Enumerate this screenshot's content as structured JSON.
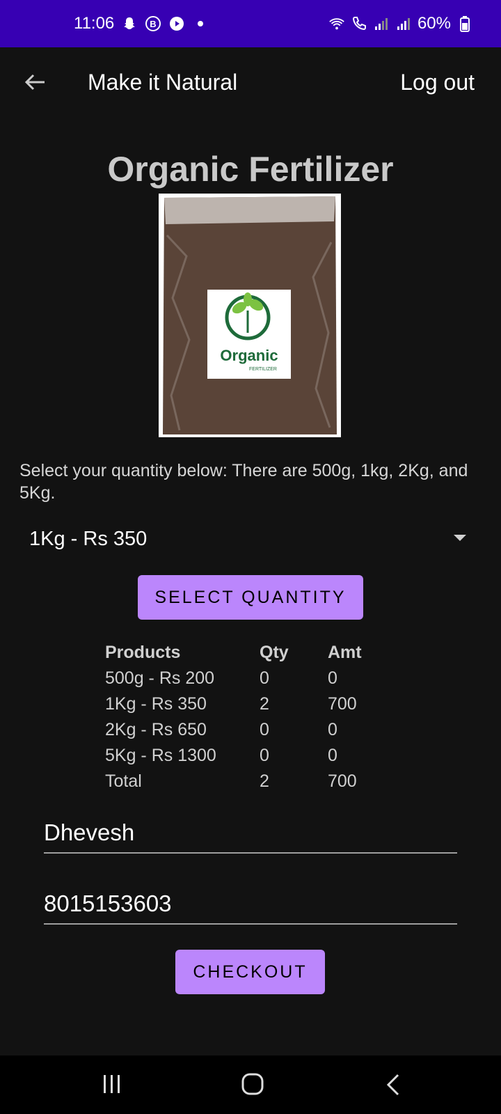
{
  "status_bar": {
    "time": "11:06",
    "battery": "60%",
    "left_icons": [
      "snapchat-icon",
      "b-icon",
      "play-icon",
      "dot-icon"
    ],
    "right_icons": [
      "wifi-icon",
      "call-icon",
      "signal-icon",
      "signal-icon",
      "battery-icon"
    ]
  },
  "app_bar": {
    "title": "Make it Natural",
    "logout_label": "Log out"
  },
  "product": {
    "title": "Organic Fertilizer",
    "image_label": "Organic",
    "image_sublabel": "FERTILIZER"
  },
  "description": "Select your quantity below: There are 500g, 1kg, 2Kg, and 5Kg.",
  "quantity_dropdown": {
    "selected": "1Kg - Rs 350"
  },
  "select_button_label": "Select Quantity",
  "order_table": {
    "headers": [
      "Products",
      "Qty",
      "Amt"
    ],
    "rows": [
      [
        "500g - Rs 200",
        "0",
        "0"
      ],
      [
        "1Kg - Rs 350",
        "2",
        "700"
      ],
      [
        "2Kg - Rs 650",
        "0",
        "0"
      ],
      [
        "5Kg - Rs 1300",
        "0",
        "0"
      ],
      [
        "Total",
        "2",
        "700"
      ]
    ]
  },
  "form": {
    "name_value": "Dhevesh",
    "phone_value": "8015153603"
  },
  "checkout_button_label": "Checkout",
  "colors": {
    "status_bar": "#3700B3",
    "accent": "#BB86FC",
    "background": "#121212"
  }
}
